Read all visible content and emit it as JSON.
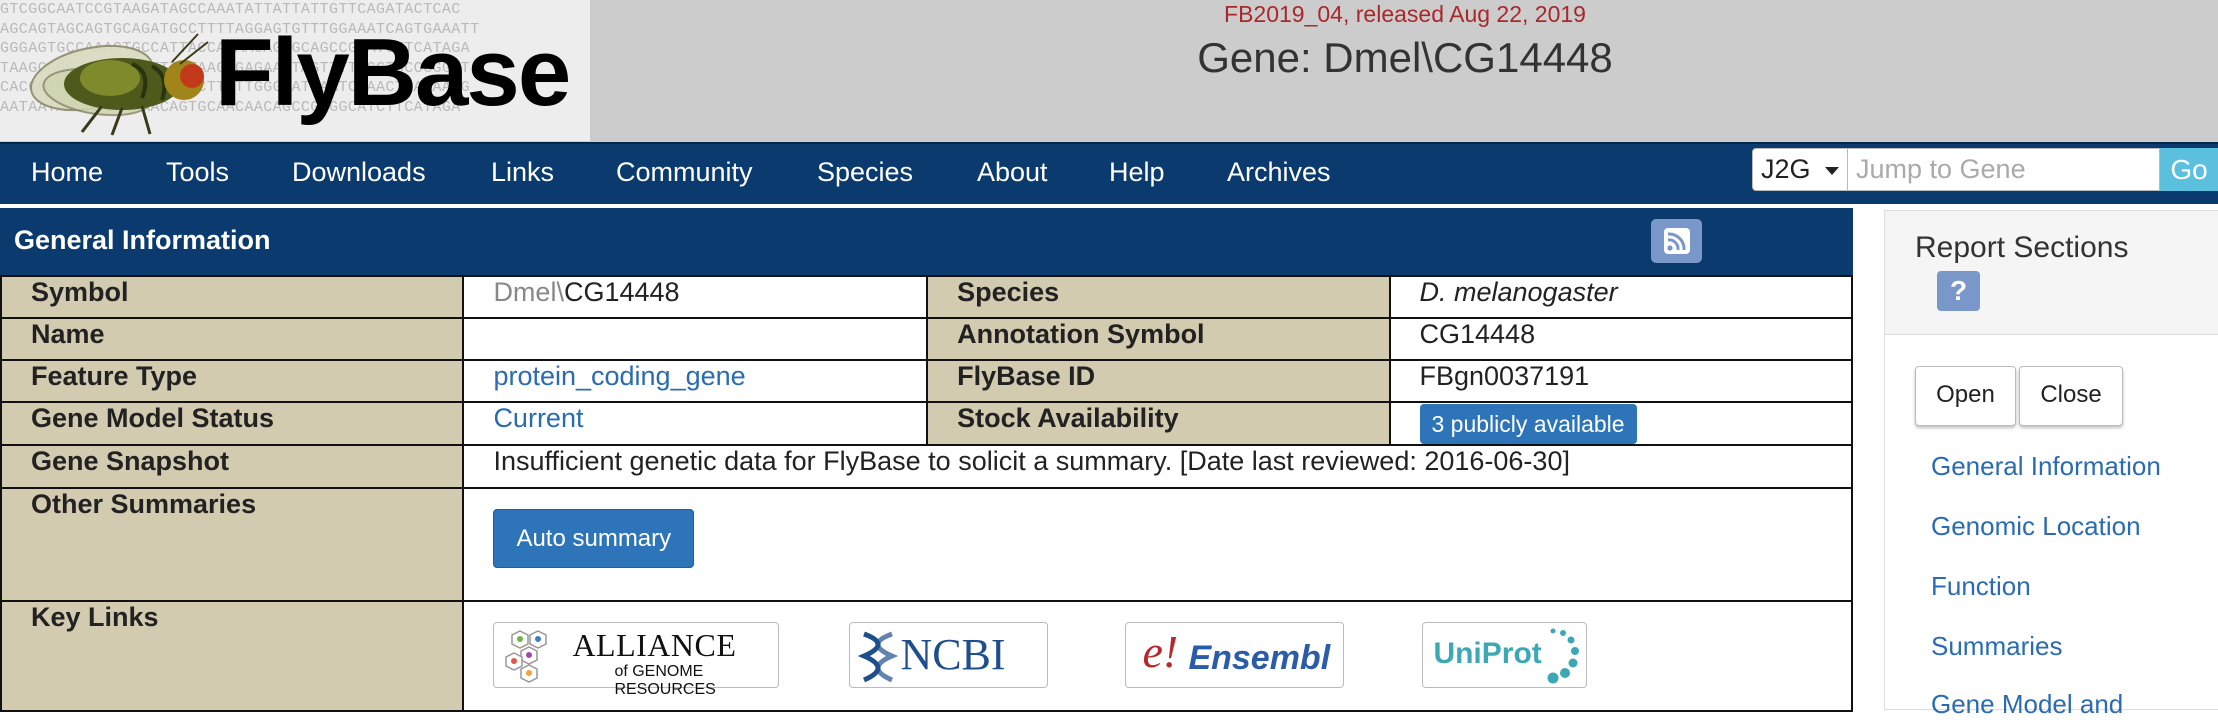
{
  "header": {
    "logo_text": "FlyBase",
    "release": "FB2019_04, released Aug 22, 2019",
    "title": "Gene: Dmel\\CG14448",
    "logo_sequence": [
      "GTCGGCAATCCGTAAGATAGCCAAATATTATTATTGTTCAGATACTCAC",
      "AGCAGTAGCAGTGCAGATGCCTTTTAGGAGTGTTTGGAAATCAGTGAAATT",
      "GGGAGTGCCAAAGTGCCATTACCACAACAGCGCAGCCGCATCTTCATAGA",
      "TAAGCAGGCACAGCGGTTTTTAAGCGAGAAGTAGTTTTGGCTGCCGGGAT",
      "CACGGAAACAGCCAAAGCGGACTTTTTGGGGATGAATCAAACTGAAAAAG",
      "AATAATAAAAACAACAACAGTGCAACAACAGCCGGGGCATCTTCATAGA"
    ]
  },
  "nav": {
    "items": [
      "Home",
      "Tools",
      "Downloads",
      "Links",
      "Community",
      "Species",
      "About",
      "Help",
      "Archives"
    ],
    "j2g_label": "J2G",
    "search_placeholder": "Jump to Gene",
    "go_label": "Go"
  },
  "general_info": {
    "heading": "General Information",
    "rows": {
      "symbol_label": "Symbol",
      "symbol_prefix": "Dmel\\",
      "symbol_value": "CG14448",
      "species_label": "Species",
      "species_value": "D. melanogaster",
      "name_label": "Name",
      "name_value": "",
      "annotation_label": "Annotation Symbol",
      "annotation_value": "CG14448",
      "feature_label": "Feature Type",
      "feature_value": "protein_coding_gene",
      "flybase_id_label": "FlyBase ID",
      "flybase_id_value": "FBgn0037191",
      "model_status_label": "Gene Model Status",
      "model_status_value": "Current",
      "stock_label": "Stock Availability",
      "stock_value": "3 publicly available",
      "snapshot_label": "Gene Snapshot",
      "snapshot_value": "Insufficient genetic data for FlyBase to solicit a summary. [Date last reviewed: 2016-06-30]",
      "other_summaries_label": "Other Summaries",
      "auto_summary_button": "Auto summary",
      "key_links_label": "Key Links"
    },
    "key_links": {
      "alliance_main": "ALLIANCE",
      "alliance_sub": "of GENOME RESOURCES",
      "ncbi": "NCBI",
      "ensembl_e": "e!",
      "ensembl": "Ensembl",
      "uniprot": "UniProt"
    }
  },
  "report_sections": {
    "title": "Report Sections",
    "help_label": "?",
    "open_label": "Open",
    "close_label": "Close",
    "links": [
      "General Information",
      "Genomic Location",
      "Function",
      "Summaries",
      "Gene Model and"
    ]
  },
  "colors": {
    "nav_bg": "#0a3a6e",
    "label_bg": "#d3cbb0",
    "link": "#2a6bb1",
    "button": "#2d74b8",
    "release_text": "#a9282b",
    "go_button": "#5bc0de"
  }
}
